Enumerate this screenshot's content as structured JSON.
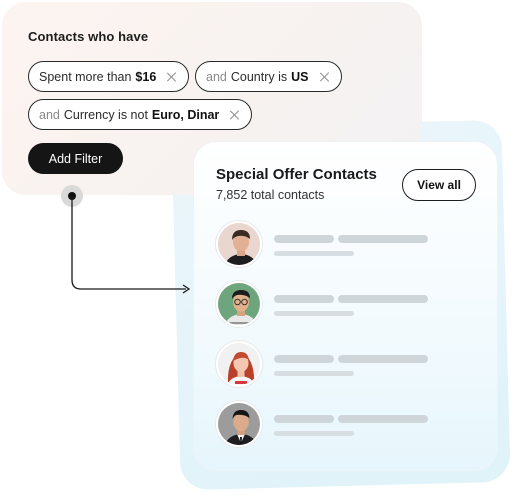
{
  "filter": {
    "title": "Contacts who have",
    "chips": [
      {
        "prefix": "",
        "label": "Spent more than",
        "value": "$16"
      },
      {
        "prefix": "and",
        "label": "Country is",
        "value": "US"
      },
      {
        "prefix": "and",
        "label": "Currency is not",
        "value": "Euro, Dinar"
      }
    ],
    "add_label": "Add Filter"
  },
  "contacts": {
    "title": "Special Offer Contacts",
    "subtitle": "7,852 total contacts",
    "view_all_label": "View all",
    "rows": 4
  },
  "colors": {
    "dark": "#151515",
    "placeholder": "#cfd6da",
    "card_tint": "#e6f6fc",
    "filter_tint": "#fdf4f1"
  },
  "icons": [
    "close-icon",
    "connector-node-icon",
    "arrow-right-icon"
  ]
}
